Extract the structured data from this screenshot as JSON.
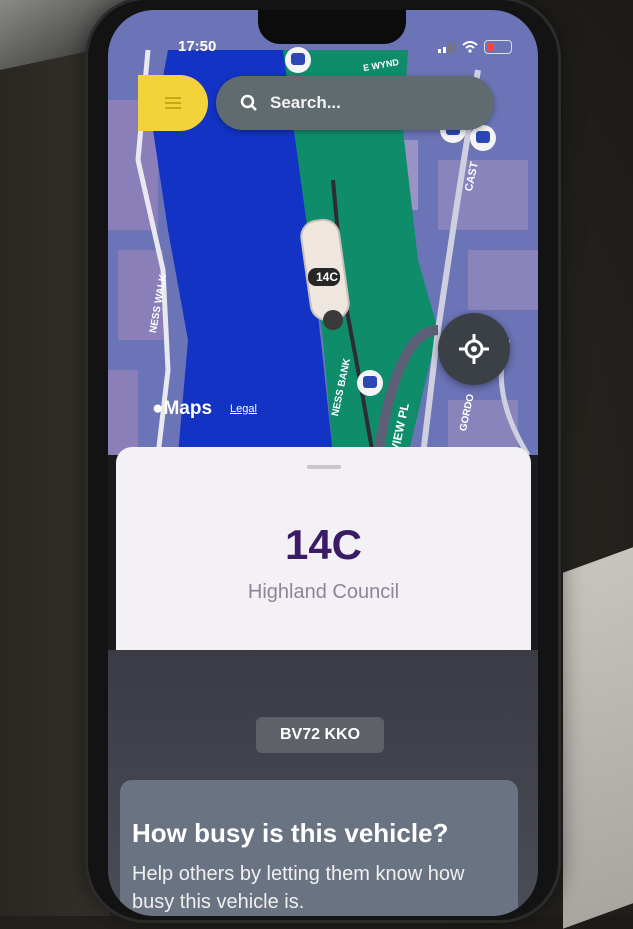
{
  "status_bar": {
    "time": "17:50"
  },
  "search": {
    "placeholder": "Search..."
  },
  "map": {
    "street_labels": [
      "NESS WALK",
      "NESS BANK",
      "VIEW PL",
      "GORDO",
      "CAST",
      "E WYND"
    ],
    "bus_badge": "14C"
  },
  "attribution": {
    "maps_brand": "Maps",
    "legal": "Legal"
  },
  "vehicle": {
    "route": "14C",
    "operator": "Highland Council",
    "registration": "BV72 KKO"
  },
  "busy_card": {
    "title": "How busy is this vehicle?",
    "body": "Help others by letting them know how busy this vehicle is."
  },
  "colors": {
    "accent": "#f3d23a",
    "route_text": "#3b1b63",
    "river": "#1233c4",
    "park": "#0f8d6a"
  }
}
